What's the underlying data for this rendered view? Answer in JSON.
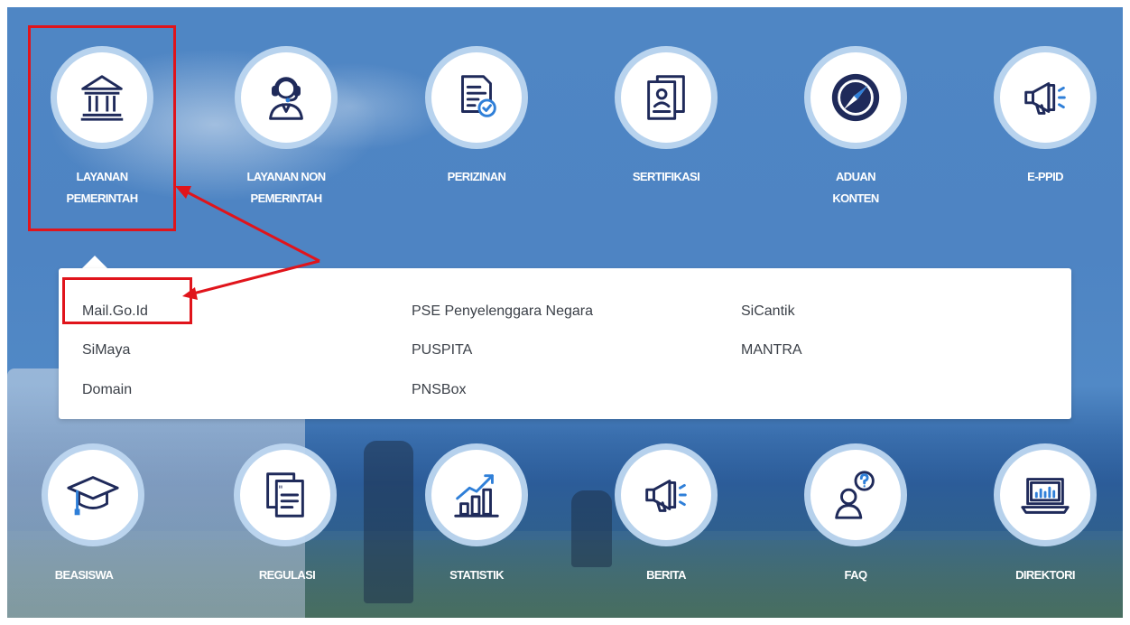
{
  "services_top": [
    {
      "label_line1": "LAYANAN",
      "label_line2": "PEMERINTAH",
      "icon": "government-building-icon"
    },
    {
      "label_line1": "LAYANAN NON",
      "label_line2": "PEMERINTAH",
      "icon": "headset-agent-icon"
    },
    {
      "label_line1": "PERIZINAN",
      "label_line2": "",
      "icon": "license-document-icon"
    },
    {
      "label_line1": "SERTIFIKASI",
      "label_line2": "",
      "icon": "certificate-id-icon"
    },
    {
      "label_line1": "ADUAN",
      "label_line2": "KONTEN",
      "icon": "compass-icon"
    },
    {
      "label_line1": "E-PPID",
      "label_line2": "",
      "icon": "megaphone-icon"
    }
  ],
  "dropdown": {
    "links": [
      [
        "Mail.Go.Id",
        "SiMaya",
        "Domain"
      ],
      [
        "PSE Penyelenggara Negara",
        "PUSPITA",
        "PNSBox"
      ],
      [
        "SiCantik",
        "MANTRA"
      ]
    ]
  },
  "services_bottom": [
    {
      "label": "BEASISWA",
      "icon": "graduation-cap-icon"
    },
    {
      "label": "REGULASI",
      "icon": "documents-icon"
    },
    {
      "label": "STATISTIK",
      "icon": "bar-chart-trend-icon"
    },
    {
      "label": "BERITA",
      "icon": "megaphone-icon"
    },
    {
      "label": "FAQ",
      "icon": "user-question-icon"
    },
    {
      "label": "DIREKTORI",
      "icon": "laptop-chart-icon"
    }
  ],
  "colors": {
    "accent_navy": "#1f2a5a",
    "accent_blue": "#2f7fd8",
    "annotation_red": "#e0141b",
    "background_blue": "#4e84c3"
  }
}
